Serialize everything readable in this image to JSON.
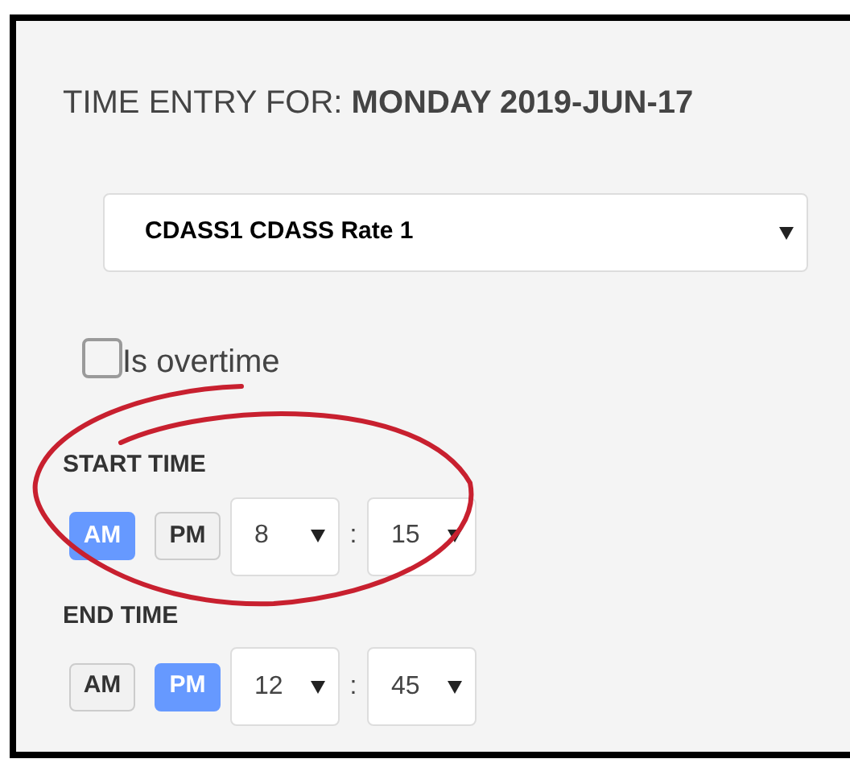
{
  "title": {
    "prefix": "TIME ENTRY FOR:",
    "date": "MONDAY 2019-JUN-17"
  },
  "rate_select": {
    "value": "CDASS1 CDASS Rate 1"
  },
  "overtime": {
    "label": "Is overtime",
    "checked": false
  },
  "times": [
    {
      "label": "START TIME",
      "meridiem": [
        {
          "label": "AM",
          "selected": true
        },
        {
          "label": "PM",
          "selected": false
        }
      ],
      "hour": "8",
      "separator": ":",
      "minute": "15"
    },
    {
      "label": "END TIME",
      "meridiem": [
        {
          "label": "AM",
          "selected": false
        },
        {
          "label": "PM",
          "selected": true
        }
      ],
      "hour": "12",
      "separator": ":",
      "minute": "45"
    }
  ]
}
